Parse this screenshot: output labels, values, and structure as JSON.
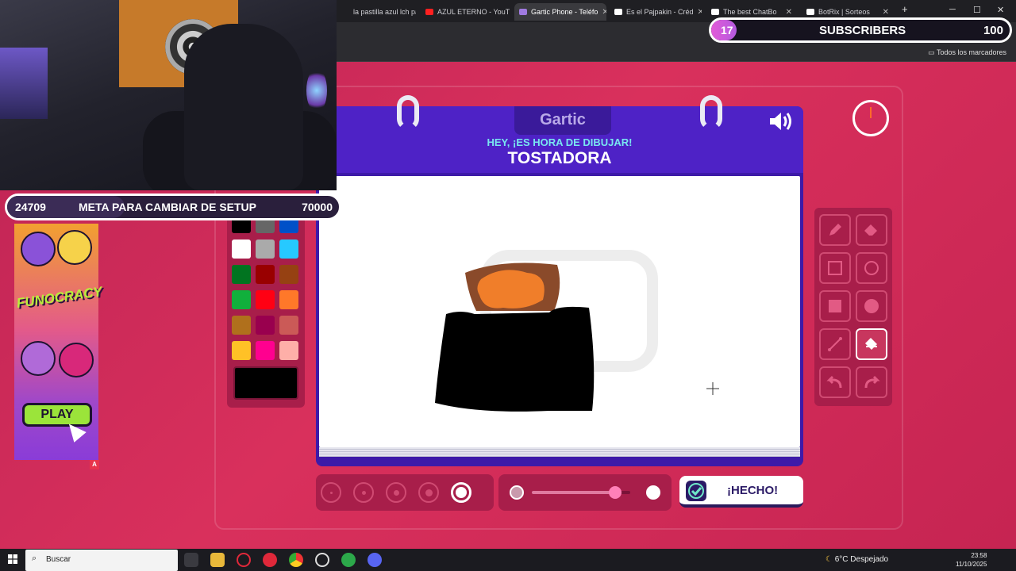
{
  "browser": {
    "tabs": [
      {
        "title": "la pastilla azul lch pa",
        "active": false
      },
      {
        "title": "AZUL ETERNO - YouT",
        "active": false,
        "icon_color": "#ff2020"
      },
      {
        "title": "Gartic Phone - Teléfo",
        "active": true,
        "icon_color": "#a07ae0"
      },
      {
        "title": "Es el Pajpakin - Créd",
        "active": false,
        "icon_color": "#ffffff"
      },
      {
        "title": "The best ChatBo",
        "active": false,
        "icon_color": "#ffffff"
      },
      {
        "title": "BotRix | Sorteos",
        "active": false,
        "icon_color": "#ffffff"
      }
    ],
    "new_tab": "+",
    "bookmarks_label": "Todos los marcadores"
  },
  "overlays": {
    "subscribers": {
      "current": "17",
      "label": "SUBSCRIBERS",
      "goal": "100",
      "progress": 0.17
    },
    "meta": {
      "current": "24709",
      "label": "META PARA CAMBIAR DE SETUP",
      "goal": "70000",
      "progress": 0.353
    },
    "fundocracy": {
      "logo": "FUNOCRACY",
      "play": "PLAY",
      "badge": "A"
    }
  },
  "game": {
    "logo": "Gartic",
    "prompt": "HEY, ¡ES HORA DE DIBUJAR!",
    "word": "TOSTADORA",
    "done_label": "¡HECHO!",
    "palette": [
      "#000000",
      "#666666",
      "#0050c8",
      "#ffffff",
      "#aaaaaa",
      "#26c9ff",
      "#017420",
      "#990000",
      "#964112",
      "#11b03c",
      "#ff0013",
      "#ff7829",
      "#b0701c",
      "#99004e",
      "#cb5a57",
      "#ffc126",
      "#ff008f",
      "#feafa8"
    ],
    "current_color": "#000000",
    "tools": [
      "pencil",
      "eraser",
      "rect-outline",
      "ellipse-outline",
      "rect-fill",
      "ellipse-fill",
      "line",
      "fill-bucket",
      "undo",
      "redo"
    ],
    "active_tool": "fill-bucket",
    "brush_sizes": [
      1,
      2,
      3,
      4,
      5
    ],
    "selected_brush_size": 5,
    "opacity": 0.85
  },
  "taskbar": {
    "search_placeholder": "Buscar",
    "weather": "6°C  Despejado",
    "time": "23:58",
    "date": "11/10/2025"
  }
}
